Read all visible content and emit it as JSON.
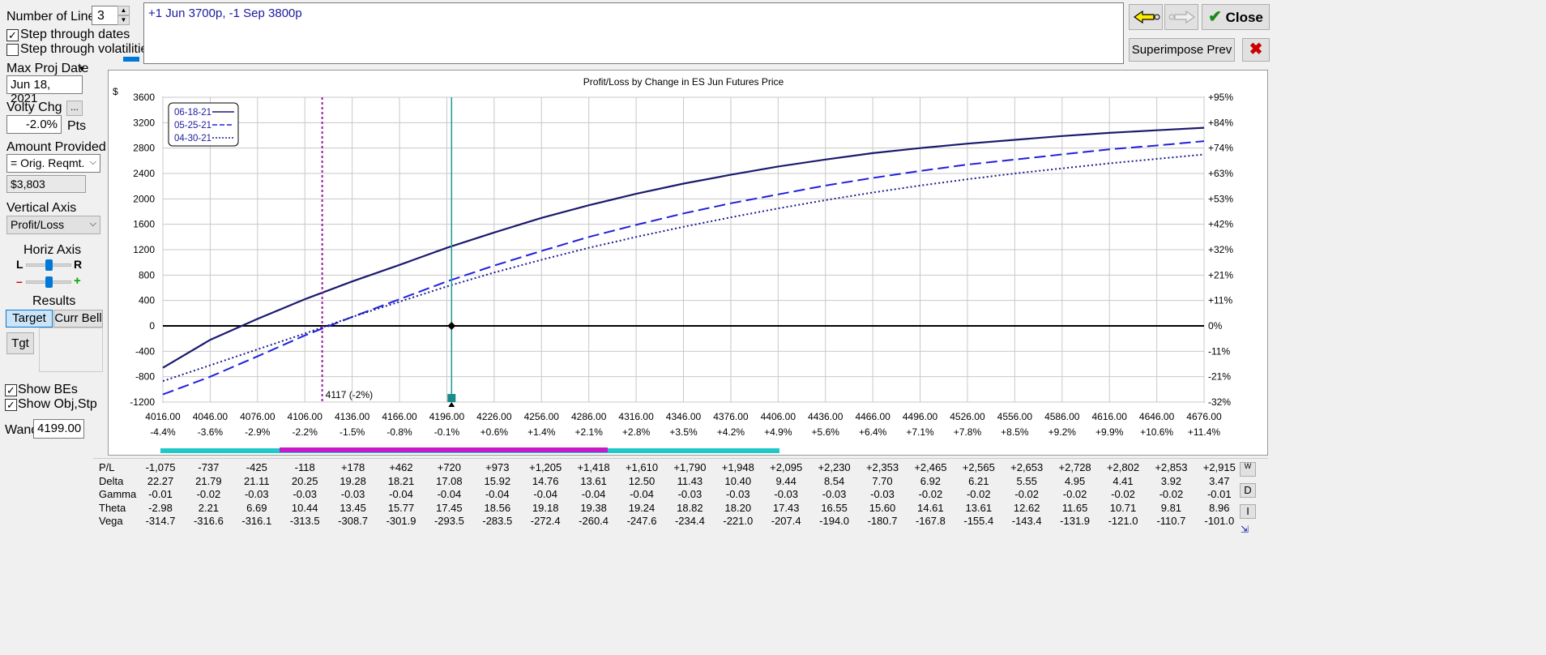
{
  "left_panel": {
    "number_of_lines_label": "Number of Lines",
    "number_of_lines_value": "3",
    "step_dates_label": "Step through dates",
    "step_dates_checked": true,
    "step_vols_label": "Step through volatilities",
    "step_vols_checked": false,
    "max_proj_date_label": "Max Proj Date",
    "max_proj_date_value": "Jun 18, 2021",
    "volty_chg_label": "Volty Chg",
    "volty_more": "...",
    "volty_value": "-2.0%",
    "volty_unit": "Pts",
    "amount_provided_label": "Amount Provided",
    "amount_provided_value": "= Orig. Reqmt.",
    "amount_value": "$3,803",
    "vertical_axis_label": "Vertical Axis",
    "vertical_axis_value": "Profit/Loss",
    "horiz_axis_label": "Horiz Axis",
    "horiz_l": "L",
    "horiz_r": "R",
    "zoom_minus": "–",
    "zoom_plus": "+",
    "results_label": "Results",
    "target_btn": "Target",
    "curr_bell_btn": "Curr Bell",
    "tgt_btn": "Tgt",
    "show_bes_label": "Show BEs",
    "show_bes_checked": true,
    "show_obj_label": "Show Obj,Stp",
    "show_obj_checked": true,
    "wand_label": "Wand",
    "wand_value": "4199.00"
  },
  "position_text": "+1 Jun 3700p, -1 Sep 3800p",
  "right_buttons": {
    "close_label": "Close",
    "superimpose_label": "Superimpose Prev"
  },
  "chart_data": {
    "type": "line",
    "title": "Profit/Loss by Change in ES Jun Futures Price",
    "y_unit": "$",
    "x": [
      4016,
      4046,
      4076,
      4106,
      4136,
      4166,
      4196,
      4226,
      4256,
      4286,
      4316,
      4346,
      4376,
      4406,
      4436,
      4466,
      4496,
      4526,
      4556,
      4586,
      4616,
      4646,
      4676
    ],
    "xlim": [
      4016,
      4676
    ],
    "ylim": [
      -1200,
      3600
    ],
    "x_tick_labels": [
      "4016.00",
      "4046.00",
      "4076.00",
      "4106.00",
      "4136.00",
      "4166.00",
      "4196.00",
      "4226.00",
      "4256.00",
      "4286.00",
      "4316.00",
      "4346.00",
      "4376.00",
      "4406.00",
      "4436.00",
      "4466.00",
      "4496.00",
      "4526.00",
      "4556.00",
      "4586.00",
      "4616.00",
      "4646.00",
      "4676.00"
    ],
    "x_pct_labels": [
      "-4.4%",
      "-3.6%",
      "-2.9%",
      "-2.2%",
      "-1.5%",
      "-0.8%",
      "-0.1%",
      "+0.6%",
      "+1.4%",
      "+2.1%",
      "+2.8%",
      "+3.5%",
      "+4.2%",
      "+4.9%",
      "+5.6%",
      "+6.4%",
      "+7.1%",
      "+7.8%",
      "+8.5%",
      "+9.2%",
      "+9.9%",
      "+10.6%",
      "+11.4%"
    ],
    "y_ticks": [
      3600,
      3200,
      2800,
      2400,
      2000,
      1600,
      1200,
      800,
      400,
      0,
      -400,
      -800,
      -1200
    ],
    "y_pct_labels": [
      "+95%",
      "+84%",
      "+74%",
      "+63%",
      "+53%",
      "+42%",
      "+32%",
      "+21%",
      "+11%",
      "0%",
      "-11%",
      "-21%",
      "-32%"
    ],
    "series": [
      {
        "name": "06-18-21",
        "style": "solid",
        "color": "#1a1a6e",
        "values": [
          -660,
          -220,
          110,
          420,
          700,
          960,
          1230,
          1470,
          1700,
          1900,
          2080,
          2240,
          2380,
          2510,
          2620,
          2720,
          2800,
          2870,
          2930,
          2990,
          3040,
          3080,
          3120
        ]
      },
      {
        "name": "05-25-21",
        "style": "dash",
        "color": "#2020dd",
        "values": [
          -1080,
          -800,
          -480,
          -150,
          140,
          420,
          700,
          950,
          1180,
          1400,
          1590,
          1770,
          1930,
          2070,
          2210,
          2330,
          2440,
          2540,
          2620,
          2700,
          2780,
          2840,
          2910
        ]
      },
      {
        "name": "04-30-21",
        "style": "dot",
        "color": "#1a1a8e",
        "values": [
          -870,
          -620,
          -370,
          -120,
          140,
          380,
          620,
          840,
          1040,
          1230,
          1400,
          1560,
          1710,
          1850,
          1980,
          2100,
          2210,
          2310,
          2400,
          2480,
          2560,
          2630,
          2700
        ]
      }
    ],
    "breakeven_label": "4117 (-2%)",
    "breakeven_x": 4117,
    "current_price_x": 4199
  },
  "greeks_table": {
    "row_labels": [
      "P/L",
      "Delta",
      "Gamma",
      "Theta",
      "Vega"
    ],
    "rows": [
      [
        "-1,075",
        "-737",
        "-425",
        "-118",
        "+178",
        "+462",
        "+720",
        "+973",
        "+1,205",
        "+1,418",
        "+1,610",
        "+1,790",
        "+1,948",
        "+2,095",
        "+2,230",
        "+2,353",
        "+2,465",
        "+2,565",
        "+2,653",
        "+2,728",
        "+2,802",
        "+2,853",
        "+2,915"
      ],
      [
        "22.27",
        "21.79",
        "21.11",
        "20.25",
        "19.28",
        "18.21",
        "17.08",
        "15.92",
        "14.76",
        "13.61",
        "12.50",
        "11.43",
        "10.40",
        "9.44",
        "8.54",
        "7.70",
        "6.92",
        "6.21",
        "5.55",
        "4.95",
        "4.41",
        "3.92",
        "3.47"
      ],
      [
        "-0.01",
        "-0.02",
        "-0.03",
        "-0.03",
        "-0.03",
        "-0.04",
        "-0.04",
        "-0.04",
        "-0.04",
        "-0.04",
        "-0.04",
        "-0.03",
        "-0.03",
        "-0.03",
        "-0.03",
        "-0.03",
        "-0.02",
        "-0.02",
        "-0.02",
        "-0.02",
        "-0.02",
        "-0.02",
        "-0.01"
      ],
      [
        "-2.98",
        "2.21",
        "6.69",
        "10.44",
        "13.45",
        "15.77",
        "17.45",
        "18.56",
        "19.18",
        "19.38",
        "19.24",
        "18.82",
        "18.20",
        "17.43",
        "16.55",
        "15.60",
        "14.61",
        "13.61",
        "12.62",
        "11.65",
        "10.71",
        "9.81",
        "8.96"
      ],
      [
        "-314.7",
        "-316.6",
        "-316.1",
        "-313.5",
        "-308.7",
        "-301.9",
        "-293.5",
        "-283.5",
        "-272.4",
        "-260.4",
        "-247.6",
        "-234.4",
        "-221.0",
        "-207.4",
        "-194.0",
        "-180.7",
        "-167.8",
        "-155.4",
        "-143.4",
        "-131.9",
        "-121.0",
        "-110.7",
        "-101.0"
      ]
    ],
    "side_buttons": [
      "W",
      "D",
      "I"
    ]
  }
}
